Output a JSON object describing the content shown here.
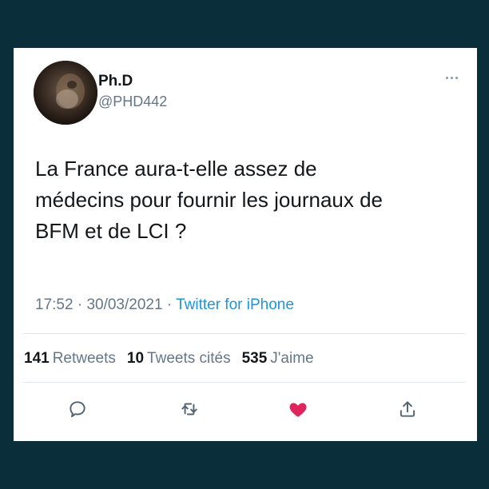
{
  "tweet": {
    "author_name": "Ph.D",
    "author_handle": "@PHD442",
    "text_lines": [
      "La France aura-t-elle assez de",
      "médecins pour fournir les journaux de",
      "BFM et de LCI ?"
    ],
    "time": "17:52",
    "date": "30/03/2021",
    "separator": "·",
    "source": "Twitter for iPhone",
    "retweets_count": "141",
    "retweets_label": "Retweets",
    "quotes_count": "10",
    "quotes_label": "Tweets cités",
    "likes_count": "535",
    "likes_label": "J'aime",
    "liked": true
  },
  "colors": {
    "background": "#0b2f3a",
    "card": "#ffffff",
    "text": "#14171a",
    "secondary": "#657786",
    "link": "#1b95e0",
    "like": "#e0245e"
  },
  "icons": [
    "more-icon",
    "reply-icon",
    "retweet-icon",
    "like-heart-icon",
    "share-icon"
  ]
}
